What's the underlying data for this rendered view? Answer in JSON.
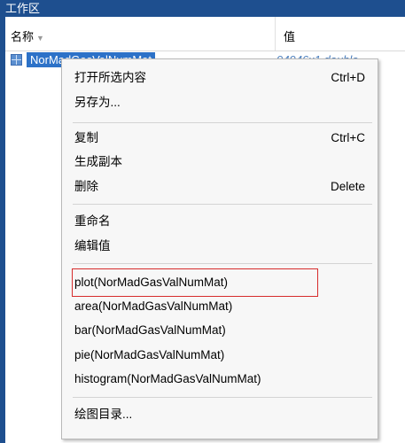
{
  "panel": {
    "title": "工作区"
  },
  "columns": {
    "name": "名称",
    "value": "值"
  },
  "variable": {
    "name": "NorMadGasValNumMat",
    "value": "94946x1 double"
  },
  "menu": {
    "open_selection": {
      "label": "打开所选内容",
      "shortcut": "Ctrl+D"
    },
    "save_as": {
      "label": "另存为..."
    },
    "copy": {
      "label": "复制",
      "shortcut": "Ctrl+C"
    },
    "duplicate": {
      "label": "生成副本"
    },
    "delete": {
      "label": "删除",
      "shortcut": "Delete"
    },
    "rename": {
      "label": "重命名"
    },
    "edit_value": {
      "label": "编辑值"
    },
    "plot": {
      "label": "plot(NorMadGasValNumMat)"
    },
    "area": {
      "label": "area(NorMadGasValNumMat)"
    },
    "bar": {
      "label": "bar(NorMadGasValNumMat)"
    },
    "pie": {
      "label": "pie(NorMadGasValNumMat)"
    },
    "histogram": {
      "label": "histogram(NorMadGasValNumMat)"
    },
    "plot_catalog": {
      "label": "绘图目录..."
    }
  },
  "colors": {
    "title_bar": "#1e4f8f",
    "selection": "#2d72c8",
    "highlight_border": "#d62c2c"
  }
}
